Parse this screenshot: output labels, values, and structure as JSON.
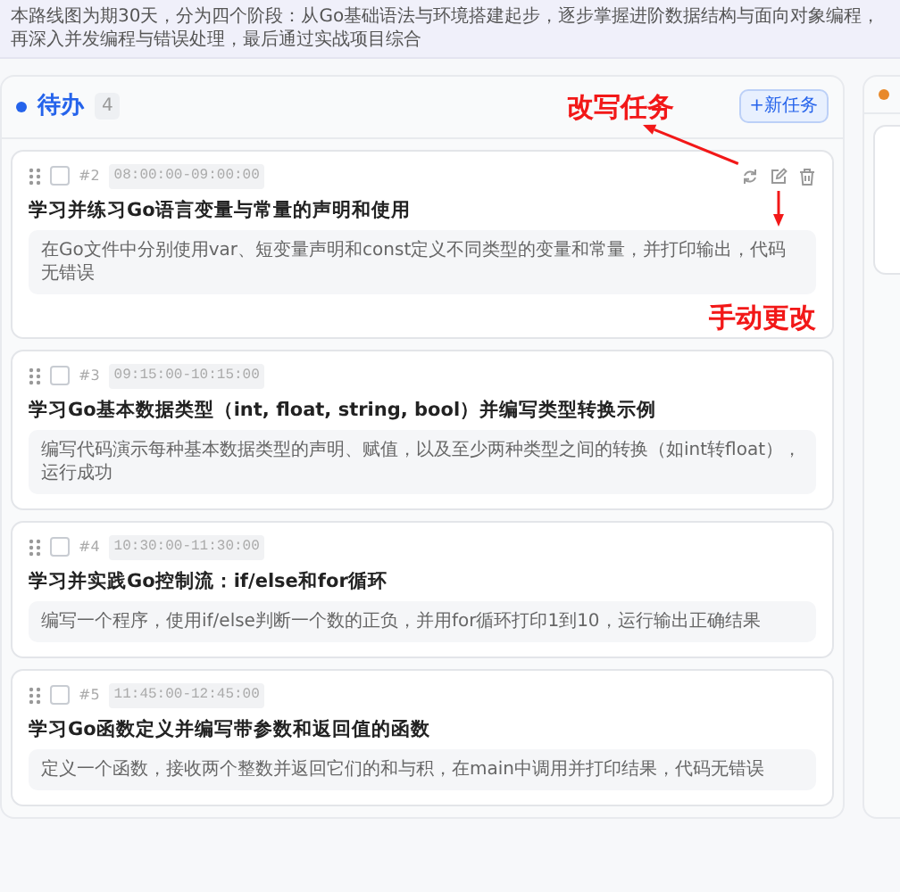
{
  "banner": "本路线图为期30天，分为四个阶段：从Go基础语法与环境搭建起步，逐步掌握进阶数据结构与面向对象编程，再深入并发编程与错误处理，最后通过实战项目综合",
  "columns": [
    {
      "title": "待办",
      "count": "4",
      "color": "#2563eb",
      "add_button": "+新任务",
      "tasks": [
        {
          "number": "#2",
          "time": "08:00:00-09:00:00",
          "title": "学习并练习Go语言变量与常量的声明和使用",
          "description": "在Go文件中分别使用var、短变量声明和const定义不同类型的变量和常量，并打印输出，代码无错误",
          "checked": false,
          "hovered": true
        },
        {
          "number": "#3",
          "time": "09:15:00-10:15:00",
          "title": "学习Go基本数据类型（int, float, string, bool）并编写类型转换示例",
          "description": "编写代码演示每种基本数据类型的声明、赋值，以及至少两种类型之间的转换（如int转float），运行成功",
          "checked": false,
          "hovered": false
        },
        {
          "number": "#4",
          "time": "10:30:00-11:30:00",
          "title": "学习并实践Go控制流：if/else和for循环",
          "description": "编写一个程序，使用if/else判断一个数的正负，并用for循环打印1到10，运行输出正确结果",
          "checked": false,
          "hovered": false
        },
        {
          "number": "#5",
          "time": "11:45:00-12:45:00",
          "title": "学习Go函数定义并编写带参数和返回值的函数",
          "description": "定义一个函数，接收两个整数并返回它们的和与积，在main中调用并打印结果，代码无错误",
          "checked": false,
          "hovered": false
        }
      ]
    },
    {
      "color": "#e8892b"
    }
  ],
  "annotations": [
    {
      "text": "改写任务"
    },
    {
      "text": "手动更改"
    }
  ]
}
